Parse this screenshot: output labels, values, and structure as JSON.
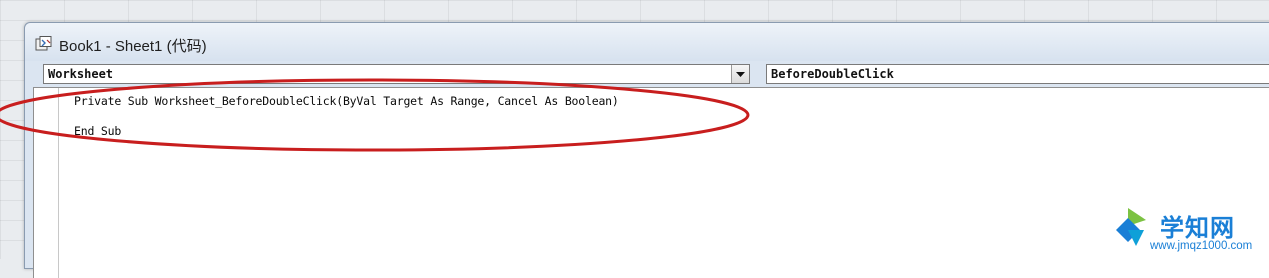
{
  "window": {
    "title": "Book1 - Sheet1 (代码)",
    "icon": "vba-module-icon"
  },
  "object_combo": {
    "value": "Worksheet",
    "icon": "chevron-down-icon"
  },
  "procedure_combo": {
    "value": "BeforeDoubleClick"
  },
  "code": {
    "lines": [
      "Private Sub Worksheet_BeforeDoubleClick(ByVal Target As Range, Cancel As Boolean)",
      "End Sub"
    ]
  },
  "annotation": {
    "shape": "ellipse",
    "color": "#c81e1e"
  },
  "watermark": {
    "main": "学知网",
    "sub": "www.jmqz1000.com",
    "color": "#1a7fd6"
  }
}
